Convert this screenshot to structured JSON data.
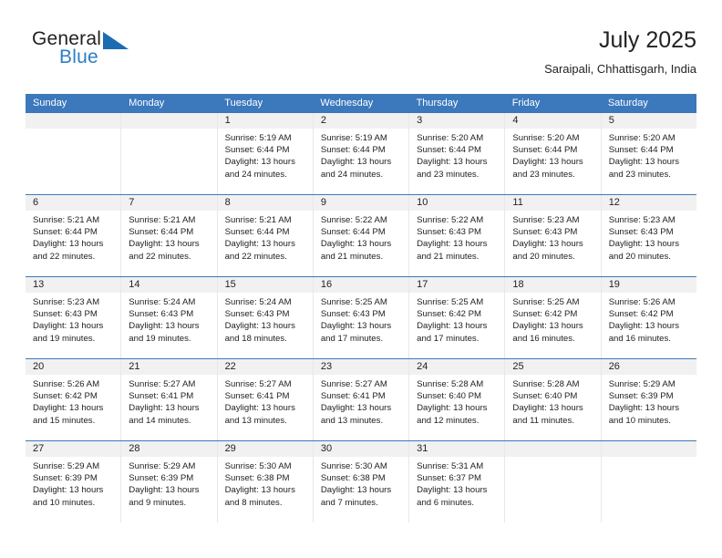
{
  "brand": {
    "name_top": "General",
    "name_bottom": "Blue",
    "flag_icon": "blue-triangle-flag-icon",
    "color_dark": "#231f20",
    "color_blue": "#2a7fc4"
  },
  "header": {
    "title": "July 2025",
    "subtitle": "Saraipali, Chhattisgarh, India"
  },
  "theme": {
    "header_blue": "#3b78bc",
    "day_band_gray": "#f1f1f1",
    "grid_line": "#e8e8e8",
    "text": "#222222"
  },
  "weekdays": [
    "Sunday",
    "Monday",
    "Tuesday",
    "Wednesday",
    "Thursday",
    "Friday",
    "Saturday"
  ],
  "weeks": [
    [
      {
        "day": "",
        "sunrise": "",
        "sunset": "",
        "daylight_line1": "",
        "daylight_line2": ""
      },
      {
        "day": "",
        "sunrise": "",
        "sunset": "",
        "daylight_line1": "",
        "daylight_line2": ""
      },
      {
        "day": "1",
        "sunrise": "Sunrise: 5:19 AM",
        "sunset": "Sunset: 6:44 PM",
        "daylight_line1": "Daylight: 13 hours",
        "daylight_line2": "and 24 minutes."
      },
      {
        "day": "2",
        "sunrise": "Sunrise: 5:19 AM",
        "sunset": "Sunset: 6:44 PM",
        "daylight_line1": "Daylight: 13 hours",
        "daylight_line2": "and 24 minutes."
      },
      {
        "day": "3",
        "sunrise": "Sunrise: 5:20 AM",
        "sunset": "Sunset: 6:44 PM",
        "daylight_line1": "Daylight: 13 hours",
        "daylight_line2": "and 23 minutes."
      },
      {
        "day": "4",
        "sunrise": "Sunrise: 5:20 AM",
        "sunset": "Sunset: 6:44 PM",
        "daylight_line1": "Daylight: 13 hours",
        "daylight_line2": "and 23 minutes."
      },
      {
        "day": "5",
        "sunrise": "Sunrise: 5:20 AM",
        "sunset": "Sunset: 6:44 PM",
        "daylight_line1": "Daylight: 13 hours",
        "daylight_line2": "and 23 minutes."
      }
    ],
    [
      {
        "day": "6",
        "sunrise": "Sunrise: 5:21 AM",
        "sunset": "Sunset: 6:44 PM",
        "daylight_line1": "Daylight: 13 hours",
        "daylight_line2": "and 22 minutes."
      },
      {
        "day": "7",
        "sunrise": "Sunrise: 5:21 AM",
        "sunset": "Sunset: 6:44 PM",
        "daylight_line1": "Daylight: 13 hours",
        "daylight_line2": "and 22 minutes."
      },
      {
        "day": "8",
        "sunrise": "Sunrise: 5:21 AM",
        "sunset": "Sunset: 6:44 PM",
        "daylight_line1": "Daylight: 13 hours",
        "daylight_line2": "and 22 minutes."
      },
      {
        "day": "9",
        "sunrise": "Sunrise: 5:22 AM",
        "sunset": "Sunset: 6:44 PM",
        "daylight_line1": "Daylight: 13 hours",
        "daylight_line2": "and 21 minutes."
      },
      {
        "day": "10",
        "sunrise": "Sunrise: 5:22 AM",
        "sunset": "Sunset: 6:43 PM",
        "daylight_line1": "Daylight: 13 hours",
        "daylight_line2": "and 21 minutes."
      },
      {
        "day": "11",
        "sunrise": "Sunrise: 5:23 AM",
        "sunset": "Sunset: 6:43 PM",
        "daylight_line1": "Daylight: 13 hours",
        "daylight_line2": "and 20 minutes."
      },
      {
        "day": "12",
        "sunrise": "Sunrise: 5:23 AM",
        "sunset": "Sunset: 6:43 PM",
        "daylight_line1": "Daylight: 13 hours",
        "daylight_line2": "and 20 minutes."
      }
    ],
    [
      {
        "day": "13",
        "sunrise": "Sunrise: 5:23 AM",
        "sunset": "Sunset: 6:43 PM",
        "daylight_line1": "Daylight: 13 hours",
        "daylight_line2": "and 19 minutes."
      },
      {
        "day": "14",
        "sunrise": "Sunrise: 5:24 AM",
        "sunset": "Sunset: 6:43 PM",
        "daylight_line1": "Daylight: 13 hours",
        "daylight_line2": "and 19 minutes."
      },
      {
        "day": "15",
        "sunrise": "Sunrise: 5:24 AM",
        "sunset": "Sunset: 6:43 PM",
        "daylight_line1": "Daylight: 13 hours",
        "daylight_line2": "and 18 minutes."
      },
      {
        "day": "16",
        "sunrise": "Sunrise: 5:25 AM",
        "sunset": "Sunset: 6:43 PM",
        "daylight_line1": "Daylight: 13 hours",
        "daylight_line2": "and 17 minutes."
      },
      {
        "day": "17",
        "sunrise": "Sunrise: 5:25 AM",
        "sunset": "Sunset: 6:42 PM",
        "daylight_line1": "Daylight: 13 hours",
        "daylight_line2": "and 17 minutes."
      },
      {
        "day": "18",
        "sunrise": "Sunrise: 5:25 AM",
        "sunset": "Sunset: 6:42 PM",
        "daylight_line1": "Daylight: 13 hours",
        "daylight_line2": "and 16 minutes."
      },
      {
        "day": "19",
        "sunrise": "Sunrise: 5:26 AM",
        "sunset": "Sunset: 6:42 PM",
        "daylight_line1": "Daylight: 13 hours",
        "daylight_line2": "and 16 minutes."
      }
    ],
    [
      {
        "day": "20",
        "sunrise": "Sunrise: 5:26 AM",
        "sunset": "Sunset: 6:42 PM",
        "daylight_line1": "Daylight: 13 hours",
        "daylight_line2": "and 15 minutes."
      },
      {
        "day": "21",
        "sunrise": "Sunrise: 5:27 AM",
        "sunset": "Sunset: 6:41 PM",
        "daylight_line1": "Daylight: 13 hours",
        "daylight_line2": "and 14 minutes."
      },
      {
        "day": "22",
        "sunrise": "Sunrise: 5:27 AM",
        "sunset": "Sunset: 6:41 PM",
        "daylight_line1": "Daylight: 13 hours",
        "daylight_line2": "and 13 minutes."
      },
      {
        "day": "23",
        "sunrise": "Sunrise: 5:27 AM",
        "sunset": "Sunset: 6:41 PM",
        "daylight_line1": "Daylight: 13 hours",
        "daylight_line2": "and 13 minutes."
      },
      {
        "day": "24",
        "sunrise": "Sunrise: 5:28 AM",
        "sunset": "Sunset: 6:40 PM",
        "daylight_line1": "Daylight: 13 hours",
        "daylight_line2": "and 12 minutes."
      },
      {
        "day": "25",
        "sunrise": "Sunrise: 5:28 AM",
        "sunset": "Sunset: 6:40 PM",
        "daylight_line1": "Daylight: 13 hours",
        "daylight_line2": "and 11 minutes."
      },
      {
        "day": "26",
        "sunrise": "Sunrise: 5:29 AM",
        "sunset": "Sunset: 6:39 PM",
        "daylight_line1": "Daylight: 13 hours",
        "daylight_line2": "and 10 minutes."
      }
    ],
    [
      {
        "day": "27",
        "sunrise": "Sunrise: 5:29 AM",
        "sunset": "Sunset: 6:39 PM",
        "daylight_line1": "Daylight: 13 hours",
        "daylight_line2": "and 10 minutes."
      },
      {
        "day": "28",
        "sunrise": "Sunrise: 5:29 AM",
        "sunset": "Sunset: 6:39 PM",
        "daylight_line1": "Daylight: 13 hours",
        "daylight_line2": "and 9 minutes."
      },
      {
        "day": "29",
        "sunrise": "Sunrise: 5:30 AM",
        "sunset": "Sunset: 6:38 PM",
        "daylight_line1": "Daylight: 13 hours",
        "daylight_line2": "and 8 minutes."
      },
      {
        "day": "30",
        "sunrise": "Sunrise: 5:30 AM",
        "sunset": "Sunset: 6:38 PM",
        "daylight_line1": "Daylight: 13 hours",
        "daylight_line2": "and 7 minutes."
      },
      {
        "day": "31",
        "sunrise": "Sunrise: 5:31 AM",
        "sunset": "Sunset: 6:37 PM",
        "daylight_line1": "Daylight: 13 hours",
        "daylight_line2": "and 6 minutes."
      },
      {
        "day": "",
        "sunrise": "",
        "sunset": "",
        "daylight_line1": "",
        "daylight_line2": ""
      },
      {
        "day": "",
        "sunrise": "",
        "sunset": "",
        "daylight_line1": "",
        "daylight_line2": ""
      }
    ]
  ]
}
